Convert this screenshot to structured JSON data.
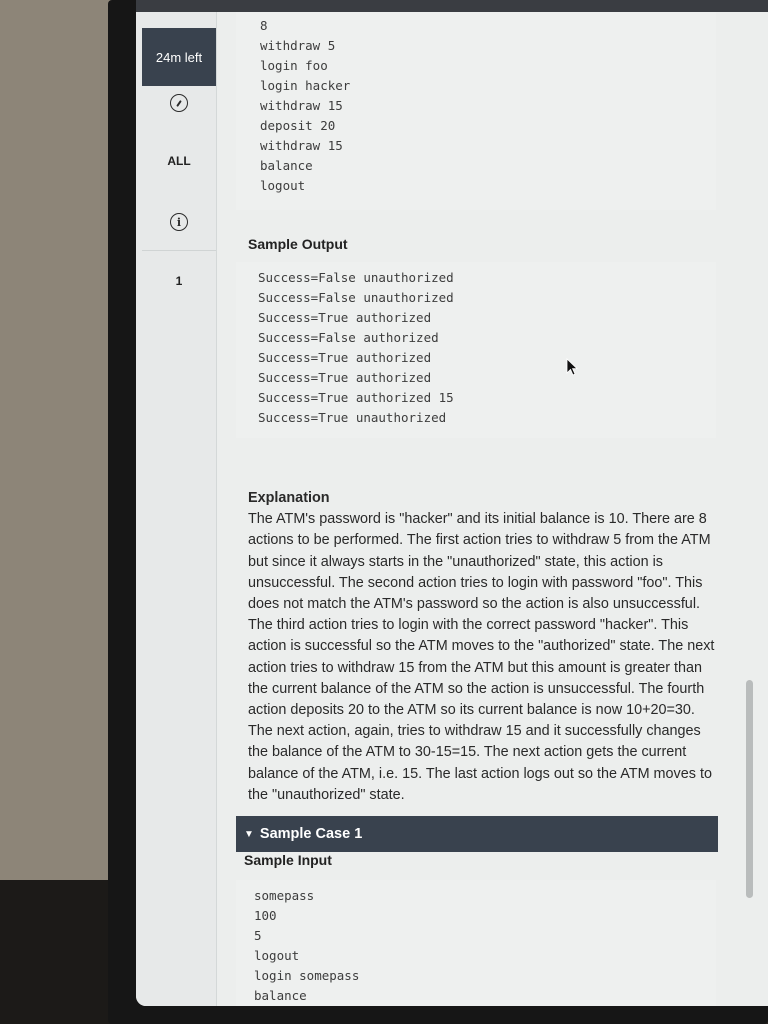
{
  "timer": {
    "label": "24m left"
  },
  "rail": {
    "all_label": "ALL",
    "question_number": "1"
  },
  "sample_input_tail": [
    "8",
    "withdraw 5",
    "login foo",
    "login hacker",
    "withdraw 15",
    "deposit 20",
    "withdraw 15",
    "balance",
    "logout"
  ],
  "sample_output": {
    "heading": "Sample Output",
    "lines": [
      "Success=False unauthorized",
      "Success=False unauthorized",
      "Success=True authorized",
      "Success=False authorized",
      "Success=True authorized",
      "Success=True authorized",
      "Success=True authorized 15",
      "Success=True unauthorized"
    ]
  },
  "explanation": {
    "heading": "Explanation",
    "text": "The ATM's password is \"hacker\" and its initial balance is 10. There are 8 actions to be performed. The first action tries to withdraw 5 from the ATM but since it always starts in the \"unauthorized\" state, this action is unsuccessful. The second action tries to login with password \"foo\". This does not match the ATM's password so the action is also unsuccessful. The third action tries to login with the correct password \"hacker\". This action is successful so the ATM moves to the \"authorized\" state. The next action tries to withdraw 15 from the ATM but this amount is greater than the current balance of the ATM so the action is unsuccessful. The fourth action deposits 20 to the ATM so its current balance is now 10+20=30. The next action, again, tries to withdraw 15 and it successfully changes the balance of the ATM to 30-15=15. The next action gets the current balance of the ATM, i.e. 15. The last action logs out so the ATM moves to the \"unauthorized\" state."
  },
  "sample_case_1": {
    "title": "Sample Case 1",
    "input_heading": "Sample Input",
    "input_lines": [
      "somepass",
      "100",
      "5",
      "logout",
      "login somepass",
      "balance"
    ]
  },
  "colors": {
    "dark_bar": "#39424e",
    "page_bg": "#eceeed"
  },
  "icons": {
    "compass": "compass-icon",
    "info": "info-icon",
    "collapse": "caret-down-icon",
    "cursor": "mouse-pointer-icon"
  }
}
